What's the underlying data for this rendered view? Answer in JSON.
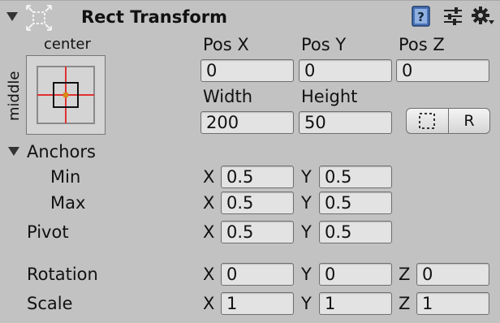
{
  "header": {
    "title": "Rect Transform"
  },
  "anchor_preset": {
    "horizontal": "center",
    "vertical": "middle"
  },
  "position": {
    "labels": [
      "Pos X",
      "Pos Y",
      "Pos Z"
    ],
    "values": [
      "0",
      "0",
      "0"
    ]
  },
  "size": {
    "width_label": "Width",
    "height_label": "Height",
    "width": "200",
    "height": "50",
    "raw_button_label": "R"
  },
  "anchors": {
    "label": "Anchors",
    "min": {
      "label": "Min",
      "x": "0.5",
      "y": "0.5"
    },
    "max": {
      "label": "Max",
      "x": "0.5",
      "y": "0.5"
    }
  },
  "pivot": {
    "label": "Pivot",
    "x": "0.5",
    "y": "0.5"
  },
  "rotation": {
    "label": "Rotation",
    "x": "0",
    "y": "0",
    "z": "0"
  },
  "scale": {
    "label": "Scale",
    "x": "1",
    "y": "1",
    "z": "1"
  },
  "axis": {
    "x": "X",
    "y": "Y",
    "z": "Z"
  },
  "icons": [
    "foldout-arrow-icon",
    "rect-transform-icon",
    "help-book-icon",
    "presets-icon",
    "gear-icon",
    "blueprint-mode-icon"
  ],
  "colors": {
    "panel": "#c2c2c2",
    "field": "#e3e3e3",
    "anchor_cross": "#e03030"
  }
}
